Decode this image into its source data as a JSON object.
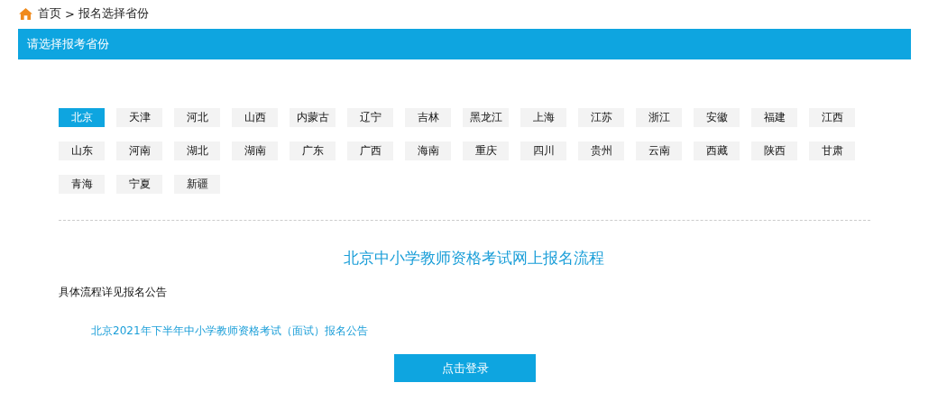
{
  "breadcrumb": {
    "home": "首页",
    "separator": ">",
    "current": "报名选择省份"
  },
  "header": {
    "title": "请选择报考省份"
  },
  "provinces": [
    {
      "label": "北京",
      "selected": true
    },
    {
      "label": "天津",
      "selected": false
    },
    {
      "label": "河北",
      "selected": false
    },
    {
      "label": "山西",
      "selected": false
    },
    {
      "label": "内蒙古",
      "selected": false
    },
    {
      "label": "辽宁",
      "selected": false
    },
    {
      "label": "吉林",
      "selected": false
    },
    {
      "label": "黑龙江",
      "selected": false
    },
    {
      "label": "上海",
      "selected": false
    },
    {
      "label": "江苏",
      "selected": false
    },
    {
      "label": "浙江",
      "selected": false
    },
    {
      "label": "安徽",
      "selected": false
    },
    {
      "label": "福建",
      "selected": false
    },
    {
      "label": "江西",
      "selected": false
    },
    {
      "label": "山东",
      "selected": false
    },
    {
      "label": "河南",
      "selected": false
    },
    {
      "label": "湖北",
      "selected": false
    },
    {
      "label": "湖南",
      "selected": false
    },
    {
      "label": "广东",
      "selected": false
    },
    {
      "label": "广西",
      "selected": false
    },
    {
      "label": "海南",
      "selected": false
    },
    {
      "label": "重庆",
      "selected": false
    },
    {
      "label": "四川",
      "selected": false
    },
    {
      "label": "贵州",
      "selected": false
    },
    {
      "label": "云南",
      "selected": false
    },
    {
      "label": "西藏",
      "selected": false
    },
    {
      "label": "陕西",
      "selected": false
    },
    {
      "label": "甘肃",
      "selected": false
    },
    {
      "label": "青海",
      "selected": false
    },
    {
      "label": "宁夏",
      "selected": false
    },
    {
      "label": "新疆",
      "selected": false
    }
  ],
  "process": {
    "title": "北京中小学教师资格考试网上报名流程",
    "note": "具体流程详见报名公告",
    "link": "北京2021年下半年中小学教师资格考试（面试）报名公告",
    "button": "点击登录"
  }
}
